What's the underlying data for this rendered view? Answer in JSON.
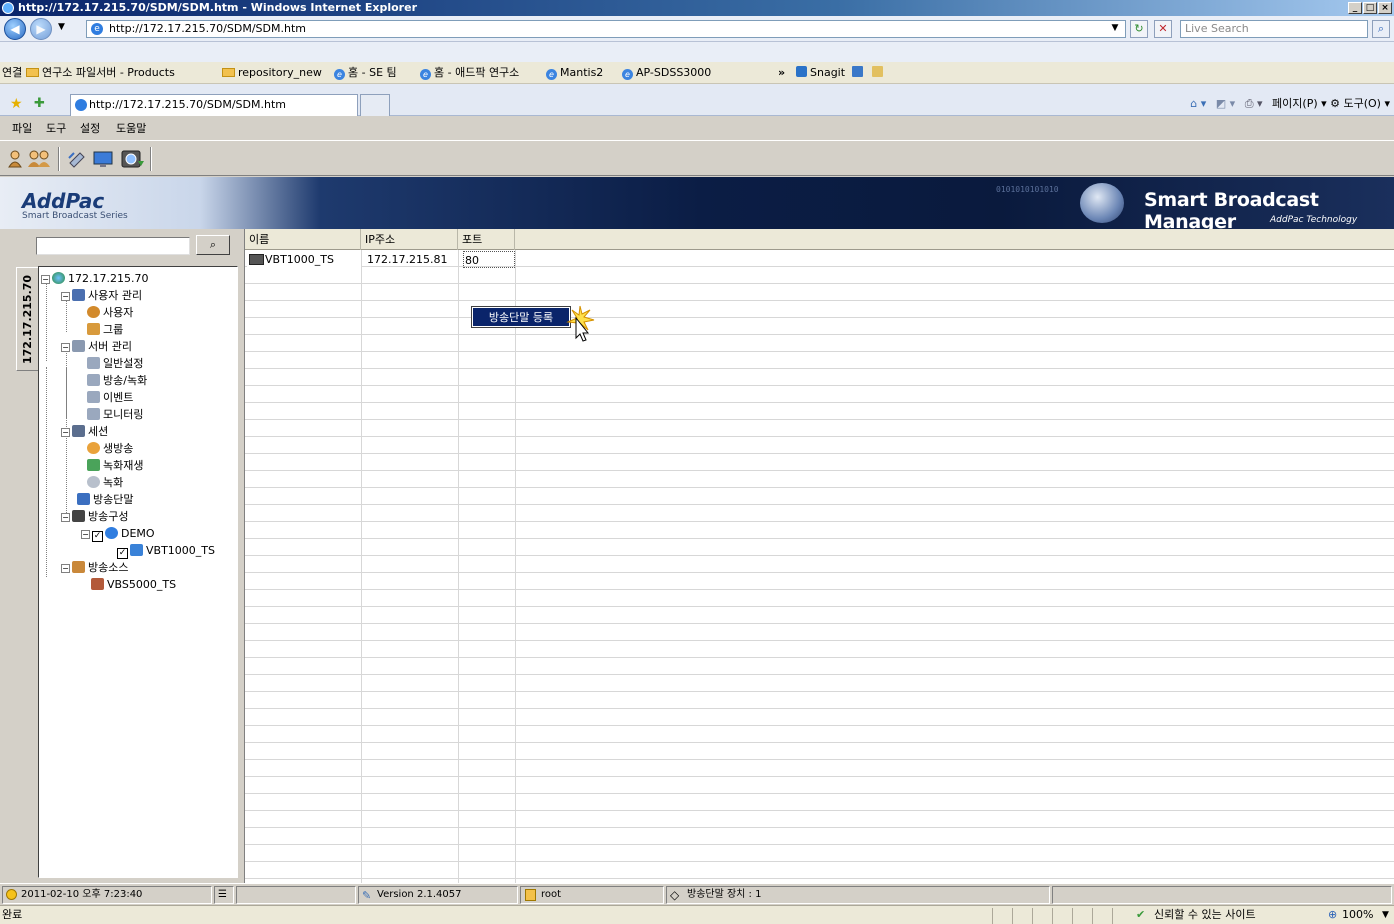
{
  "window": {
    "title": "http://172.17.215.70/SDM/SDM.htm - Windows Internet Explorer"
  },
  "address_bar": {
    "url": "http://172.17.215.70/SDM/SDM.htm",
    "search_placeholder": "Live Search"
  },
  "links_bar": {
    "label": "연결",
    "items": [
      {
        "label": "연구소 파일서버 - Products",
        "icon": "folder-icon"
      },
      {
        "label": "repository_new",
        "icon": "folder-icon"
      },
      {
        "label": "홈 - SE 팀",
        "icon": "ie-page-icon"
      },
      {
        "label": "홈 - 애드팍 연구소",
        "icon": "ie-page-icon"
      },
      {
        "label": "Mantis2",
        "icon": "ie-page-icon"
      },
      {
        "label": "AP-SDSS3000",
        "icon": "ie-page-icon"
      }
    ],
    "overflow": "»",
    "snagit": "Snagit"
  },
  "tab_row": {
    "active_tab": "http://172.17.215.70/SDM/SDM.htm",
    "commands": "페이지(P) ▾  ⚙ 도구(O) ▾"
  },
  "menu": {
    "items": [
      "파일",
      "도구",
      "설정",
      "도움말"
    ]
  },
  "banner": {
    "logo": "AddPac",
    "logo_sub": "Smart Broadcast Series",
    "title": "Smart Broadcast Manager",
    "subtitle": "AddPac Technology",
    "binary": "0101010101010"
  },
  "tree": {
    "tab_label": "172.17.215.70",
    "nodes": [
      {
        "label": "172.17.215.70",
        "icon": "network-globe-icon"
      },
      {
        "label": "사용자 관리",
        "icon": "user-management-icon"
      },
      {
        "label": "사용자",
        "icon": "user-icon"
      },
      {
        "label": "그룹",
        "icon": "group-icon"
      },
      {
        "label": "서버 관리",
        "icon": "server-icon"
      },
      {
        "label": "일반설정",
        "icon": "server-page-icon"
      },
      {
        "label": "방송/녹화",
        "icon": "server-page-icon"
      },
      {
        "label": "이벤트",
        "icon": "server-page-icon"
      },
      {
        "label": "모니터링",
        "icon": "server-page-icon"
      },
      {
        "label": "세션",
        "icon": "session-icon"
      },
      {
        "label": "생방송",
        "icon": "live-broadcast-icon"
      },
      {
        "label": "녹화재생",
        "icon": "playback-icon"
      },
      {
        "label": "녹화",
        "icon": "record-icon"
      },
      {
        "label": "방송단말",
        "icon": "terminal-icon"
      },
      {
        "label": "방송구성",
        "icon": "broadcast-config-icon"
      },
      {
        "label": "DEMO",
        "icon": "demo-icon"
      },
      {
        "label": "VBT1000_TS",
        "icon": "vbt-terminal-icon"
      },
      {
        "label": "방송소스",
        "icon": "broadcast-source-icon"
      },
      {
        "label": "VBS5000_TS",
        "icon": "vbs-source-icon"
      }
    ]
  },
  "table": {
    "columns": [
      "이름",
      "IP주소",
      "포트"
    ],
    "rows": [
      {
        "name": "VBT1000_TS",
        "ip": "172.17.215.81",
        "port": "80"
      }
    ]
  },
  "context_menu": {
    "item": "방송단말 등록"
  },
  "app_status": {
    "datetime": "2011-02-10 오후 7:23:40",
    "version": "Version 2.1.4057",
    "user": "root",
    "device_count": "방송단말 장치 : 1"
  },
  "ie_status": {
    "left": "완료",
    "zone": "신뢰할 수 있는 사이트",
    "zoom": "100%"
  },
  "colors": {
    "titlebar": "#0a246a",
    "selection": "#0a246a",
    "banner_dark": "#0b1d45"
  }
}
